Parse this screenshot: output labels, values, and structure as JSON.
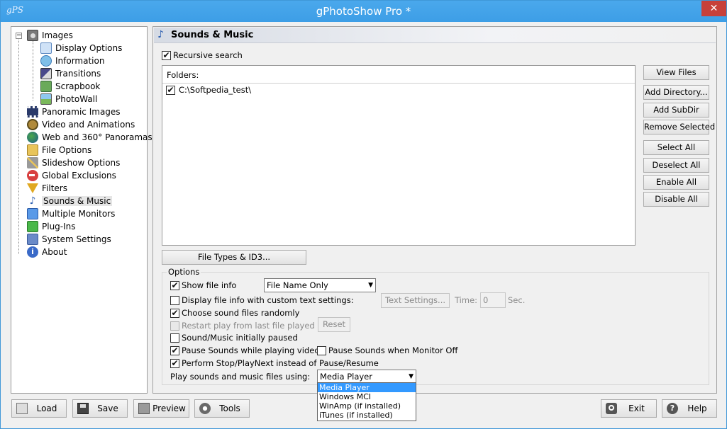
{
  "window": {
    "title": "gPhotoShow Pro *",
    "app_icon_text": "gPS",
    "close_glyph": "✕"
  },
  "tree": {
    "expander": "−",
    "items": [
      {
        "label": "Images",
        "icon": "camera-icon",
        "color": "#6d6d6d"
      },
      {
        "label": "Display Options",
        "icon": "monitor-icon",
        "color": "#6f9fd8"
      },
      {
        "label": "Information",
        "icon": "info-globe-icon",
        "color": "#4a9fd6"
      },
      {
        "label": "Transitions",
        "icon": "transitions-icon",
        "color": "#5a5a8a"
      },
      {
        "label": "Scrapbook",
        "icon": "scrapbook-icon",
        "color": "#4a9a4a"
      },
      {
        "label": "PhotoWall",
        "icon": "photowall-icon",
        "color": "#6aa84f"
      },
      {
        "label": "Panoramic Images",
        "icon": "filmstrip-icon",
        "color": "#2a3a6a"
      },
      {
        "label": "Video and Animations",
        "icon": "film-reel-icon",
        "color": "#8a6a2a"
      },
      {
        "label": "Web and 360° Panoramas",
        "icon": "globe-icon",
        "color": "#2a7a3a"
      },
      {
        "label": "File Options",
        "icon": "folder-icon",
        "color": "#d8b04a"
      },
      {
        "label": "Slideshow Options",
        "icon": "tools-icon",
        "color": "#8a8a8a"
      },
      {
        "label": "Global Exclusions",
        "icon": "no-entry-icon",
        "color": "#d84040"
      },
      {
        "label": "Filters",
        "icon": "filter-icon",
        "color": "#d8a020"
      },
      {
        "label": "Sounds & Music",
        "icon": "music-note-icon",
        "color": "#2a5db0"
      },
      {
        "label": "Multiple Monitors",
        "icon": "monitors-icon",
        "color": "#3a7ad8"
      },
      {
        "label": "Plug-Ins",
        "icon": "puzzle-icon",
        "color": "#3aa83a"
      },
      {
        "label": "System Settings",
        "icon": "settings-icon",
        "color": "#3a6aaa"
      },
      {
        "label": "About",
        "icon": "info-icon",
        "color": "#2a5db0"
      }
    ]
  },
  "panel": {
    "title": "Sounds & Music",
    "note_glyph": "♪",
    "recursive_search": {
      "label": "Recursive search",
      "checked": "✔"
    },
    "folders": {
      "header": "Folders:",
      "rows": [
        {
          "path": "C:\\Softpedia_test\\",
          "checked": "✔"
        }
      ]
    },
    "side_buttons": {
      "view_files": "View Files",
      "add_directory": "Add Directory...",
      "add_subdir": "Add SubDir",
      "remove_selected": "Remove Selected",
      "select_all": "Select All",
      "deselect_all": "Deselect All",
      "enable_all": "Enable All",
      "disable_all": "Disable All"
    },
    "file_types_button": "File Types & ID3...",
    "options": {
      "legend": "Options",
      "show_file_info": {
        "label": "Show file info",
        "checked": "✔"
      },
      "file_info_mode": "File Name Only",
      "display_custom": {
        "label": "Display file info with custom text settings:",
        "checked": ""
      },
      "text_settings_button": "Text Settings...",
      "time_label": "Time:",
      "time_value": "0",
      "sec_label": "Sec.",
      "random": {
        "label": "Choose sound files randomly",
        "checked": "✔"
      },
      "restart": {
        "label": "Restart play from last file played",
        "checked": ""
      },
      "reset_button": "Reset",
      "initially_paused": {
        "label": "Sound/Music initially paused",
        "checked": ""
      },
      "pause_video": {
        "label": "Pause Sounds while playing video",
        "checked": "✔"
      },
      "pause_monitor_off": {
        "label": "Pause Sounds when Monitor Off",
        "checked": ""
      },
      "stop_playnext": {
        "label": "Perform Stop/PlayNext instead of Pause/Resume",
        "checked": "✔"
      },
      "play_using_label": "Play sounds and music files using:",
      "play_using_value": "Media Player",
      "play_using_options": [
        "Media Player",
        "Windows MCI",
        "WinAmp (if installed)",
        "iTunes (if installed)"
      ]
    }
  },
  "bottom_bar": {
    "load": "Load",
    "save": "Save",
    "preview": "Preview",
    "tools": "Tools",
    "exit": "Exit",
    "help": "Help"
  }
}
